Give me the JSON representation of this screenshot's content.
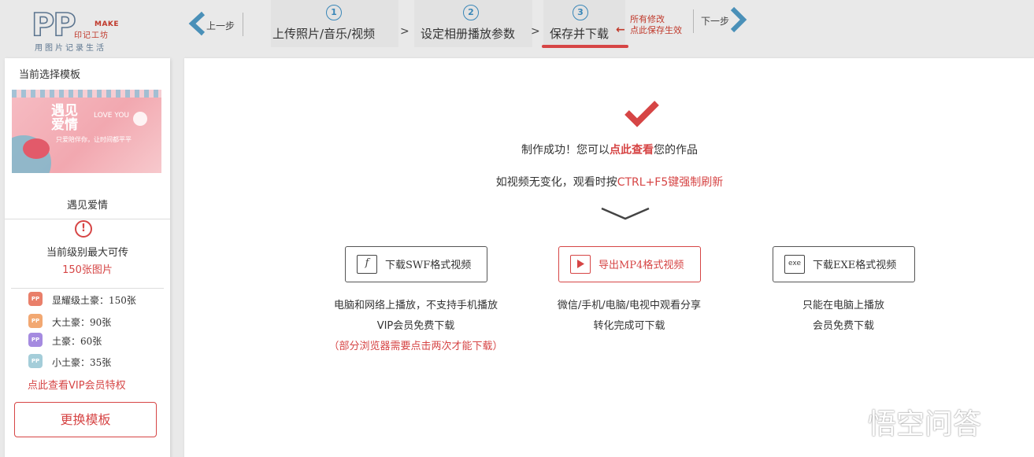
{
  "header": {
    "logo": {
      "mark": "PP",
      "make": "MAKE",
      "brand": "印记工坊",
      "slogan": "用图片记录生活"
    },
    "prev_label": "上一步",
    "next_label": "下一步",
    "steps": [
      {
        "num": "1",
        "label": "上传照片/音乐/视频"
      },
      {
        "num": "2",
        "label": "设定相册播放参数"
      },
      {
        "num": "3",
        "label": "保存并下载"
      }
    ],
    "separator": ">",
    "note_line1": "所有修改",
    "note_line2": "点此保存生效",
    "accent_color": "#d64545",
    "step_color": "#3a87b8"
  },
  "sidebar": {
    "title": "当前选择模板",
    "thumb": {
      "title": "遇见爱情",
      "love": "LOVE YOU",
      "line": "只爱陪伴你，让时间都平平"
    },
    "template_name": "遇见爱情",
    "warn_symbol": "!",
    "limit_text": "当前级别最大可传",
    "limit_value": "150张图片",
    "levels": [
      {
        "icon": "PP",
        "label": "显耀级土豪：150张"
      },
      {
        "icon": "PP",
        "label": "大土豪：90张"
      },
      {
        "icon": "PP",
        "label": "土豪：60张"
      },
      {
        "icon": "PP",
        "label": "小土豪：35张"
      }
    ],
    "vip_link": "点此查看VIP会员特权",
    "change_button": "更换模板"
  },
  "main": {
    "success_prefix": "制作成功！您可以",
    "success_link": "点此查看",
    "success_suffix": "您的作品",
    "hint_prefix": "如视频无变化，观看时按",
    "hint_highlight": "CTRL+F5键强制刷新",
    "buttons": [
      {
        "icon": "flash-icon",
        "icon_text": "f",
        "label": "下载SWF格式视频"
      },
      {
        "icon": "play-icon",
        "icon_text": "",
        "label": "导出MP4格式视频"
      },
      {
        "icon": "exe-icon",
        "icon_text": "exe",
        "label": "下载EXE格式视频"
      }
    ],
    "desc_swf": [
      "电脑和网络上播放，不支持手机播放",
      "VIP会员免费下载",
      "（部分浏览器需要点击两次才能下载）"
    ],
    "desc_mp4": [
      "微信/手机/电脑/电视中观看分享",
      "转化完成可下载"
    ],
    "desc_exe": [
      "只能在电脑上播放",
      "会员免费下载"
    ]
  },
  "watermark": "悟空问答"
}
